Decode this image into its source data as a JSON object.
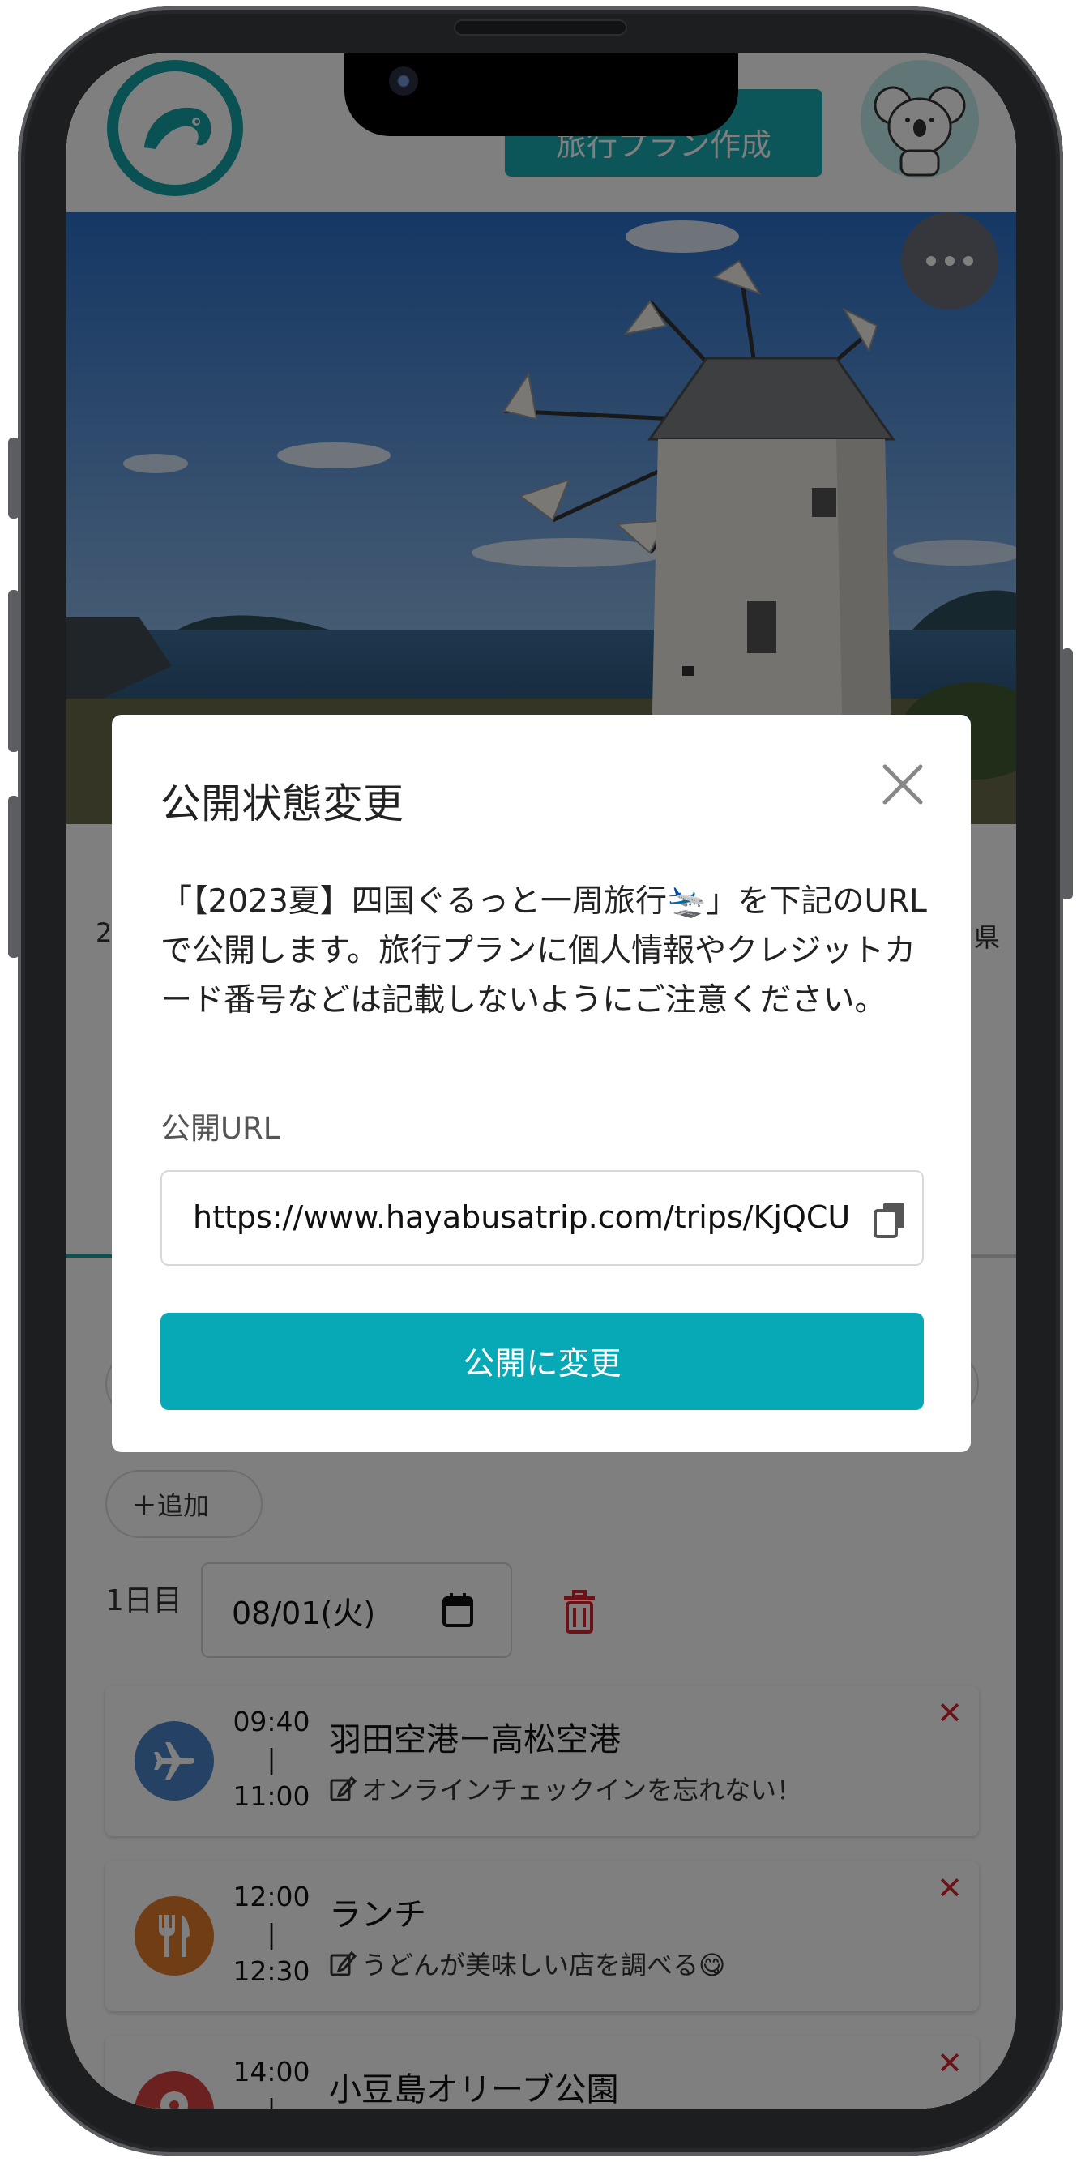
{
  "header": {
    "create_button_label": "旅行プラン作成"
  },
  "background": {
    "left_snippet": "2",
    "right_snippet": "県",
    "add_button_label": "＋追加"
  },
  "day": {
    "label": "1日目",
    "date": "08/01(火)"
  },
  "schedule": [
    {
      "start": "09:40",
      "sep": "|",
      "end": "11:00",
      "title": "羽田空港ー高松空港",
      "memo": "オンラインチェックインを忘れない！",
      "icon": "airplane-icon",
      "color": "#4a82c6"
    },
    {
      "start": "12:00",
      "sep": "|",
      "end": "12:30",
      "title": "ランチ",
      "memo": "うどんが美味しい店を調べる😋",
      "icon": "fork-knife-icon",
      "color": "#e07a2b"
    },
    {
      "start": "14:00",
      "sep": "|",
      "end": "",
      "title": "小豆島オリーブ公園",
      "memo": "",
      "icon": "map-pin-icon",
      "color": "#d94343"
    }
  ],
  "modal": {
    "title": "公開状態変更",
    "message": "「【2023夏】四国ぐるっと一周旅行🛬」を下記のURLで公開します。旅行プランに個人情報やクレジットカード番号などは記載しないようにご注意ください。",
    "url_label": "公開URL",
    "url_value": "https://www.hayabusatrip.com/trips/KjQCU",
    "publish_button_label": "公開に変更"
  },
  "colors": {
    "brand": "#14a2a8",
    "primary_button": "#06a9b5",
    "delete": "#d8232a"
  }
}
